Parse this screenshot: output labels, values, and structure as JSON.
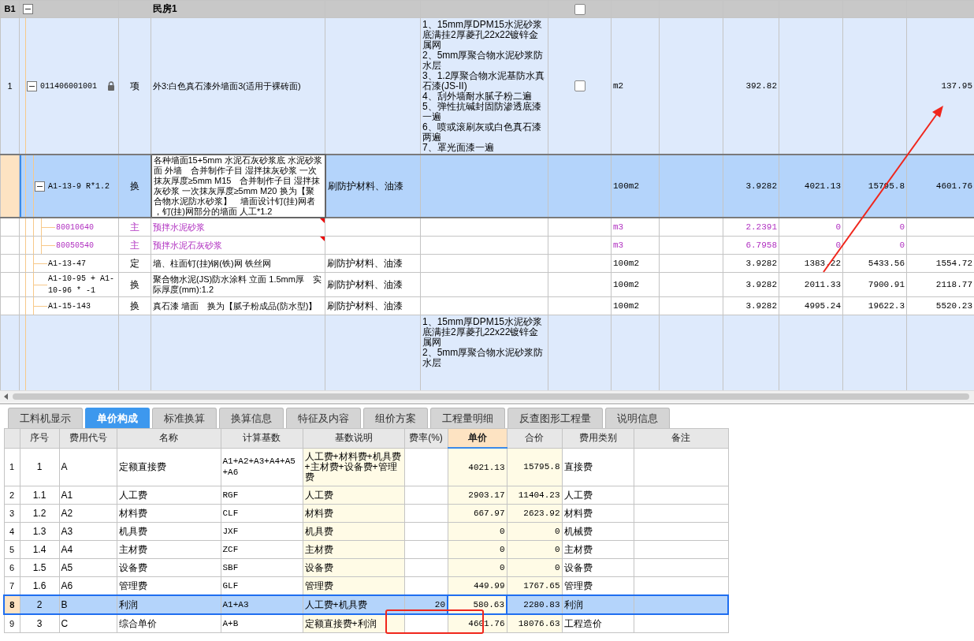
{
  "tree": {
    "row_number": "B1",
    "expanded": true,
    "name": "民房1",
    "checked": false,
    "children": [
      {
        "kind": "item",
        "row_number": "1",
        "code": "011406001001",
        "type": "项",
        "name": "外3:白色真石漆外墙面3(适用于裸砖面)",
        "column_6": "1、15mm厚DPM15水泥砂浆底满挂2厚菱孔22x22镀锌金属网\n2、5mm厚聚合物水泥砂浆防水层\n3、1.2厚聚合物水泥基防水真石漆(JS-II)\n4、刮外墙耐水腻子粉二遍\n5、弹性抗碱封固防渗透底漆一遍\n6、喷或滚刷灰或白色真石漆两遍\n7、罩光面漆一遍",
        "locked": true,
        "checked": false,
        "expanded": true,
        "selected": false,
        "column_8": "m2",
        "column_10": "392.82",
        "column_13": "137.95",
        "children": [
          {
            "kind": "quota",
            "code": "A1-13-9 R*1.2",
            "type": "换",
            "name": "各种墙面15+5mm 水泥石灰砂浆底 水泥砂浆面 外墙　合并制作子目 湿拌抹灰砂浆 一次抹灰厚度≥5mm M15　合并制作子目 湿拌抹灰砂浆 一次抹灰厚度≥5mm M20 换为【聚合物水泥防水砂浆】　墙面设计钉(挂)网者，钉(挂)网部分的墙面 人工*1.2",
            "column_5": "刷防护材料、油漆",
            "locked": false,
            "expanded": true,
            "selected": true,
            "column_8": "100m2",
            "column_10": "3.9282",
            "column_11": "4021.13",
            "column_12": "15795.8",
            "column_13": "4601.76",
            "children": [
              {
                "kind": "material",
                "code": "80010640",
                "type": "主",
                "name": "预拌水泥砂浆",
                "locked": false,
                "selected": false,
                "column_8": "m3",
                "column_10": "2.2391",
                "column_11": "0",
                "column_12": "0"
              },
              {
                "kind": "material",
                "code": "80050540",
                "type": "主",
                "name": "预拌水泥石灰砂浆",
                "locked": false,
                "selected": false,
                "column_8": "m3",
                "column_10": "6.7958",
                "column_11": "0",
                "column_12": "0"
              }
            ]
          },
          {
            "kind": "quota",
            "code": "A1-13-47",
            "type": "定",
            "name": "墙、柱面钉(挂)钢(铁)网 铁丝网",
            "column_5": "刷防护材料、油漆",
            "locked": false,
            "selected": false,
            "column_8": "100m2",
            "column_10": "3.9282",
            "column_11": "1383.22",
            "column_12": "5433.56",
            "column_13": "1554.72"
          },
          {
            "kind": "quota",
            "code": "A1-10-95 + A1-10-96 * -1",
            "type": "换",
            "name": "聚合物水泥(JS)防水涂料 立面 1.5mm厚　实际厚度(mm):1.2",
            "column_5": "刷防护材料、油漆",
            "locked": false,
            "selected": false,
            "column_8": "100m2",
            "column_10": "3.9282",
            "column_11": "2011.33",
            "column_12": "7900.91",
            "column_13": "2118.77"
          },
          {
            "kind": "quota",
            "code": "A1-15-143",
            "type": "换",
            "name": "真石漆 墙面　换为【腻子粉成品(防水型)】",
            "column_5": "刷防护材料、油漆",
            "locked": false,
            "selected": false,
            "column_8": "100m2",
            "column_10": "3.9282",
            "column_11": "4995.24",
            "column_12": "19622.3",
            "column_13": "5520.23"
          }
        ]
      },
      {
        "kind": "item",
        "column_6": "1、15mm厚DPM15水泥砂浆底满挂2厚菱孔22x22镀锌金属网\n2、5mm厚聚合物水泥砂浆防水层",
        "locked": false,
        "selected": false
      }
    ]
  },
  "tabs": [
    {
      "label": "工料机显示",
      "selected": false
    },
    {
      "label": "单价构成",
      "selected": true
    },
    {
      "label": "标准换算",
      "selected": false
    },
    {
      "label": "换算信息",
      "selected": false
    },
    {
      "label": "特征及内容",
      "selected": false
    },
    {
      "label": "组价方案",
      "selected": false
    },
    {
      "label": "工程量明细",
      "selected": false
    },
    {
      "label": "反查图形工程量",
      "selected": false
    },
    {
      "label": "说明信息",
      "selected": false
    }
  ],
  "cost_table": {
    "columns": [
      {
        "label": "序号",
        "selected": false,
        "shaded": false
      },
      {
        "label": "费用代号",
        "selected": false,
        "shaded": false
      },
      {
        "label": "名称",
        "selected": false,
        "shaded": false
      },
      {
        "label": "计算基数",
        "selected": false,
        "shaded": false
      },
      {
        "label": "基数说明",
        "selected": false,
        "shaded": true
      },
      {
        "label": "费率(%)",
        "selected": false,
        "shaded": false
      },
      {
        "label": "单价",
        "selected": true,
        "shaded": true
      },
      {
        "label": "合价",
        "selected": false,
        "shaded": true
      },
      {
        "label": "费用类别",
        "selected": false,
        "shaded": false
      },
      {
        "label": "备注",
        "selected": false,
        "shaded": false
      }
    ],
    "rows": [
      {
        "row_number": "1",
        "cells": [
          "1",
          "A",
          "定额直接费",
          "A1+A2+A3+A4+A5+A6",
          "人工费+材料费+机具费+主材费+设备费+管理费",
          "",
          "4021.13",
          "15795.8",
          "直接费",
          ""
        ],
        "selected": false
      },
      {
        "row_number": "2",
        "cells": [
          "1.1",
          "A1",
          "人工费",
          "RGF",
          "人工费",
          "",
          "2903.17",
          "11404.23",
          "人工费",
          ""
        ],
        "selected": false
      },
      {
        "row_number": "3",
        "cells": [
          "1.2",
          "A2",
          "材料费",
          "CLF",
          "材料费",
          "",
          "667.97",
          "2623.92",
          "材料费",
          ""
        ],
        "selected": false
      },
      {
        "row_number": "4",
        "cells": [
          "1.3",
          "A3",
          "机具费",
          "JXF",
          "机具费",
          "",
          "0",
          "0",
          "机械费",
          ""
        ],
        "selected": false
      },
      {
        "row_number": "5",
        "cells": [
          "1.4",
          "A4",
          "主材费",
          "ZCF",
          "主材费",
          "",
          "0",
          "0",
          "主材费",
          ""
        ],
        "selected": false
      },
      {
        "row_number": "6",
        "cells": [
          "1.5",
          "A5",
          "设备费",
          "SBF",
          "设备费",
          "",
          "0",
          "0",
          "设备费",
          ""
        ],
        "selected": false
      },
      {
        "row_number": "7",
        "cells": [
          "1.6",
          "A6",
          "管理费",
          "GLF",
          "管理费",
          "",
          "449.99",
          "1767.65",
          "管理费",
          ""
        ],
        "selected": false
      },
      {
        "row_number": "8",
        "cells": [
          "2",
          "B",
          "利润",
          "A1+A3",
          "人工费+机具费",
          "20",
          "580.63",
          "2280.83",
          "利润",
          ""
        ],
        "selected": true
      },
      {
        "row_number": "9",
        "cells": [
          "3",
          "C",
          "综合单价",
          "A+B",
          "定额直接费+利润",
          "",
          "4601.76",
          "18076.63",
          "工程造价",
          ""
        ],
        "selected": false
      }
    ]
  }
}
